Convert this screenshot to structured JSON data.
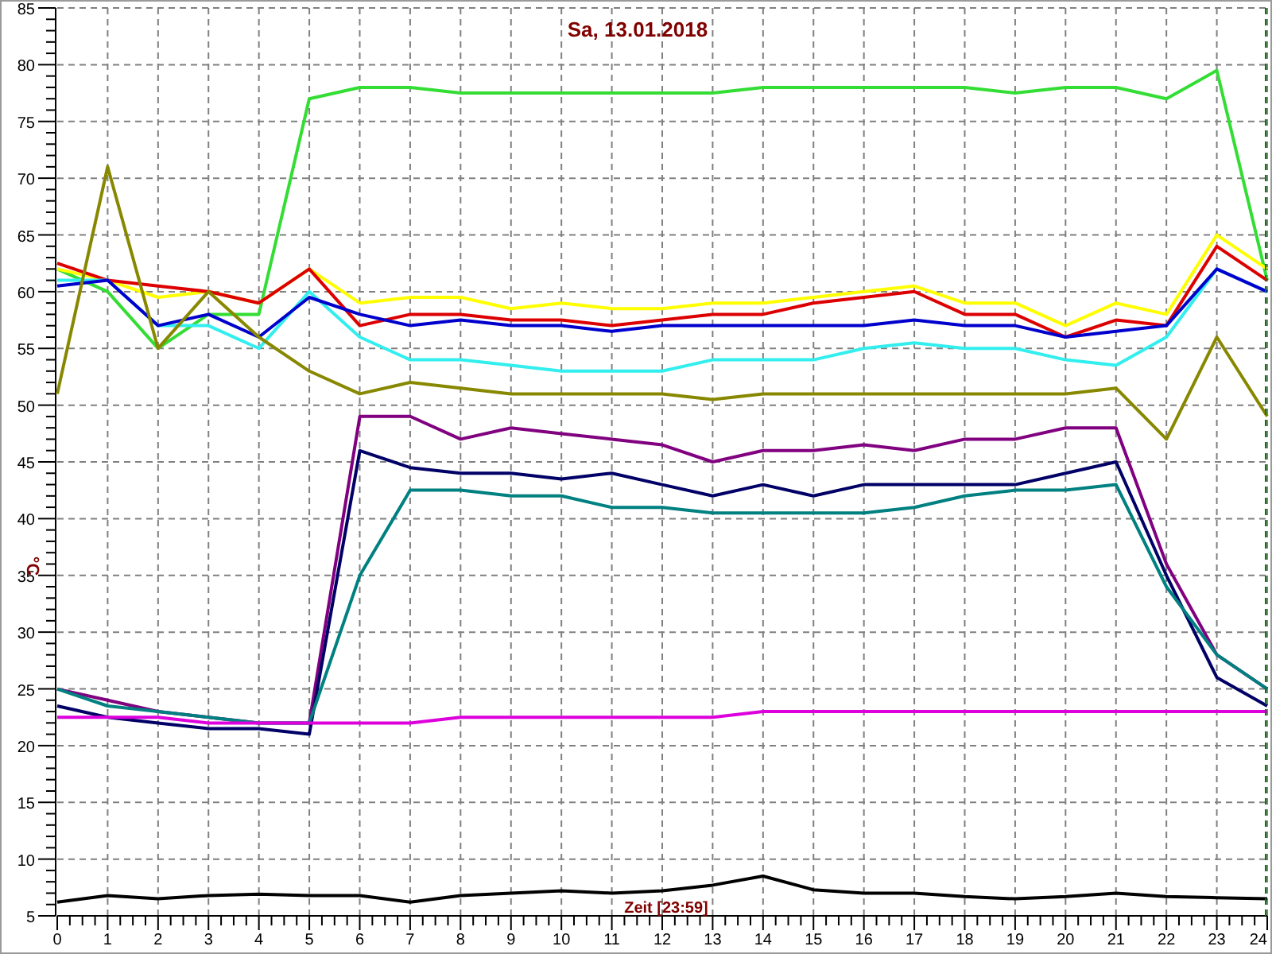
{
  "chart": {
    "chart_data": {
      "type": "line",
      "title": "Sa, 13.01.2018",
      "xlabel": "Zeit [23:59]",
      "ylabel": "°C",
      "x": [
        0,
        1,
        2,
        3,
        4,
        5,
        6,
        7,
        8,
        9,
        10,
        11,
        12,
        13,
        14,
        15,
        16,
        17,
        18,
        19,
        20,
        21,
        22,
        23,
        24
      ],
      "grid": true,
      "xlim": [
        0,
        24
      ],
      "ylim": [
        5,
        85
      ],
      "xticks": [
        0,
        1,
        2,
        3,
        4,
        5,
        6,
        7,
        8,
        9,
        10,
        11,
        12,
        13,
        14,
        15,
        16,
        17,
        18,
        19,
        20,
        21,
        22,
        23,
        24
      ],
      "yticks": [
        5,
        10,
        15,
        20,
        25,
        30,
        35,
        40,
        45,
        50,
        55,
        60,
        65,
        70,
        75,
        80,
        85
      ],
      "series": [
        {
          "color": "#33dd33",
          "values": [
            62,
            60,
            55,
            58,
            58,
            77,
            78,
            78,
            77.5,
            77.5,
            77.5,
            77.5,
            77.5,
            77.5,
            78,
            78,
            78,
            78,
            78,
            77.5,
            78,
            78,
            77,
            79.5,
            61
          ]
        },
        {
          "color": "#ffff00",
          "values": [
            62,
            61,
            59.5,
            60,
            59,
            62,
            59,
            59.5,
            59.5,
            58.5,
            59,
            58.5,
            58.5,
            59,
            59,
            59.5,
            60,
            60.5,
            59,
            59,
            57,
            59,
            58,
            65,
            62
          ]
        },
        {
          "color": "#dd0000",
          "values": [
            62.5,
            61,
            60.5,
            60,
            59,
            62,
            57,
            58,
            58,
            57.5,
            57.5,
            57,
            57.5,
            58,
            58,
            59,
            59.5,
            60,
            58,
            58,
            56,
            57.5,
            57,
            64,
            61
          ]
        },
        {
          "color": "#33eeee",
          "values": [
            61,
            61,
            57,
            57,
            55,
            60,
            56,
            54,
            54,
            53.5,
            53,
            53,
            53,
            54,
            54,
            54,
            55,
            55.5,
            55,
            55,
            54,
            53.5,
            56,
            62,
            60
          ]
        },
        {
          "color": "#0000cc",
          "values": [
            60.5,
            61,
            57,
            58,
            56,
            59.5,
            58,
            57,
            57.5,
            57,
            57,
            56.5,
            57,
            57,
            57,
            57,
            57,
            57.5,
            57,
            57,
            56,
            56.5,
            57,
            62,
            60
          ]
        },
        {
          "color": "#888800",
          "values": [
            51,
            71,
            55,
            60,
            56,
            53,
            51,
            52,
            51.5,
            51,
            51,
            51,
            51,
            50.5,
            51,
            51,
            51,
            51,
            51,
            51,
            51,
            51.5,
            47,
            56,
            49
          ]
        },
        {
          "color": "#800080",
          "values": [
            25,
            24,
            23,
            22.5,
            22,
            22,
            49,
            49,
            47,
            48,
            47.5,
            47,
            46.5,
            45,
            46,
            46,
            46.5,
            46,
            47,
            47,
            48,
            48,
            36,
            28,
            25
          ]
        },
        {
          "color": "#000066",
          "values": [
            23.5,
            22.5,
            22,
            21.5,
            21.5,
            21,
            46,
            44.5,
            44,
            44,
            43.5,
            44,
            43,
            42,
            43,
            42,
            43,
            43,
            43,
            43,
            44,
            45,
            35,
            26,
            23.5
          ]
        },
        {
          "color": "#008080",
          "values": [
            25,
            23.5,
            23,
            22.5,
            22,
            22,
            35,
            42.5,
            42.5,
            42,
            42,
            41,
            41,
            40.5,
            40.5,
            40.5,
            40.5,
            41,
            42,
            42.5,
            42.5,
            43,
            34,
            28,
            25
          ]
        },
        {
          "color": "#dd00dd",
          "values": [
            22.5,
            22.5,
            22.5,
            22,
            22,
            22,
            22,
            22,
            22.5,
            22.5,
            22.5,
            22.5,
            22.5,
            22.5,
            23,
            23,
            23,
            23,
            23,
            23,
            23,
            23,
            23,
            23,
            23
          ]
        },
        {
          "color": "#000000",
          "values": [
            6.2,
            6.8,
            6.5,
            6.8,
            6.9,
            6.8,
            6.8,
            6.2,
            6.8,
            7,
            7.2,
            7,
            7.2,
            7.7,
            8.5,
            7.3,
            7,
            7,
            6.7,
            6.5,
            6.7,
            7,
            6.7,
            6.6,
            6.5
          ]
        }
      ]
    }
  }
}
